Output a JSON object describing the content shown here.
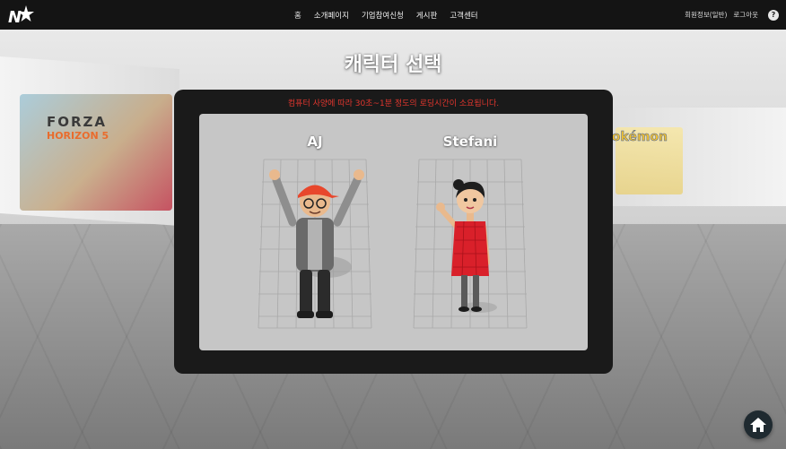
{
  "nav": {
    "items": [
      "홈",
      "소개페이지",
      "기업참여신청",
      "게시판",
      "고객센터"
    ]
  },
  "user_menu": {
    "profile": "회원정보(일반)",
    "logout": "로그아웃",
    "help_icon": "?"
  },
  "page_title": "캐릭터 선택",
  "notice": "컴퓨터 사양에 따라 30초~1분 정도의 로딩시간이 소요됩니다.",
  "characters": [
    {
      "name": "AJ"
    },
    {
      "name": "Stefani"
    }
  ],
  "background": {
    "left_logo": "FORZA",
    "left_logo_sub": "HORIZON 5",
    "right_logo": "Pokémon"
  },
  "icons": {
    "logo": "nx-star-logo",
    "help": "question-circle-icon",
    "home": "home-icon"
  },
  "colors": {
    "topbar": "#141414",
    "panel": "#1a1a1a",
    "notice": "#e2362e",
    "home_button": "#1f2a30"
  }
}
